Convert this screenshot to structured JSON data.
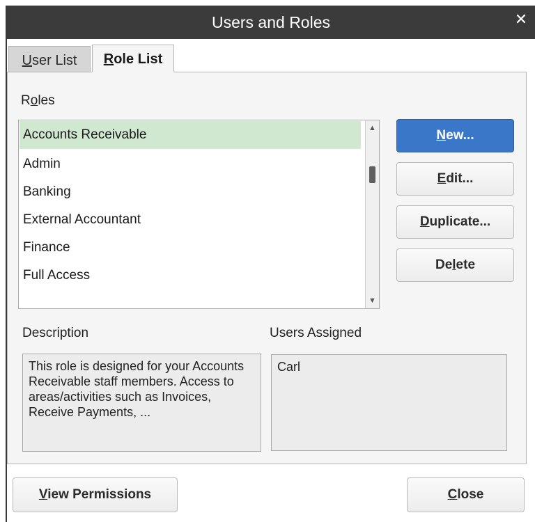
{
  "window": {
    "title": "Users and Roles"
  },
  "tabs": [
    {
      "pre": "",
      "key": "U",
      "post": "ser List",
      "active": false
    },
    {
      "pre": "",
      "key": "R",
      "post": "ole List",
      "active": true
    }
  ],
  "roles": {
    "label_pre": "R",
    "label_key": "o",
    "label_post": "les",
    "items": [
      "Accounts Receivable",
      "Admin",
      "Banking",
      "External Accountant",
      "Finance",
      "Full Access"
    ],
    "selected_index": 0
  },
  "buttons": {
    "new": {
      "pre": "",
      "key": "N",
      "post": "ew..."
    },
    "edit": {
      "pre": "",
      "key": "E",
      "post": "dit..."
    },
    "duplicate": {
      "pre": "",
      "key": "D",
      "post": "uplicate..."
    },
    "delete": {
      "pre": "De",
      "key": "l",
      "post": "ete"
    },
    "view_permissions": {
      "pre": "",
      "key": "V",
      "post": "iew Permissions"
    },
    "close": {
      "pre": "",
      "key": "C",
      "post": "lose"
    }
  },
  "description": {
    "label": "Description",
    "text": "This role is designed for your Accounts Receivable staff members. Access to areas/activities such as Invoices, Receive Payments, ..."
  },
  "users_assigned": {
    "label": "Users Assigned",
    "users": [
      "Carl"
    ]
  },
  "colors": {
    "titlebar": "#3b3b3b",
    "selected_row": "#cfe8cf",
    "primary_button": "#3a77c8"
  }
}
